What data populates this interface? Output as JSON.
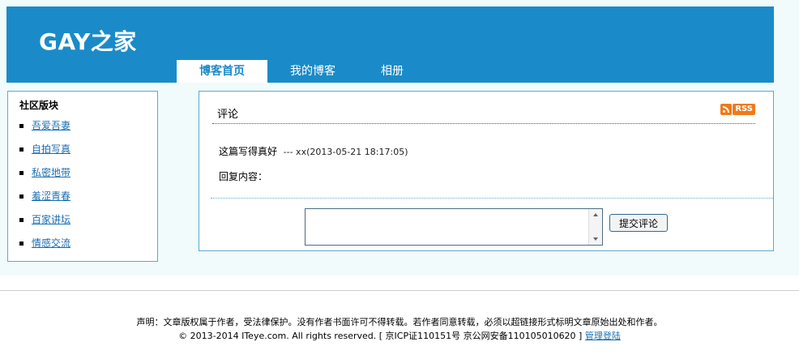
{
  "header": {
    "site_title": "GAY之家",
    "tabs": [
      {
        "label": "博客首页",
        "active": true
      },
      {
        "label": "我的博客",
        "active": false
      },
      {
        "label": "相册",
        "active": false
      }
    ]
  },
  "sidebar": {
    "title": "社区版块",
    "items": [
      {
        "label": "吾爱吾妻"
      },
      {
        "label": "自拍写真"
      },
      {
        "label": "私密地带"
      },
      {
        "label": "羞涩青春"
      },
      {
        "label": "百家讲坛"
      },
      {
        "label": "情感交流"
      }
    ]
  },
  "main": {
    "panel_title": "评论",
    "rss_label": "RSS",
    "comment": {
      "text": "这篇写得真好",
      "meta": "--- xx(2013-05-21 18:17:05)"
    },
    "reply_label": "回复内容：",
    "comment_input": {
      "value": ""
    },
    "submit_label": "提交评论"
  },
  "footer": {
    "line1": "声明：文章版权属于作者，受法律保护。没有作者书面许可不得转载。若作者同意转载，必须以超链接形式标明文章原始出处和作者。",
    "line2": "© 2013-2014 ITeye.com. All rights reserved. [ 京ICP证110151号  京公网安备110105010620 ]",
    "admin_link": "管理登陆"
  },
  "colors": {
    "header_bg": "#1a8bc8",
    "border": "#5aa9d6",
    "link": "#1a6fb3",
    "rss": "#f07a1a"
  }
}
